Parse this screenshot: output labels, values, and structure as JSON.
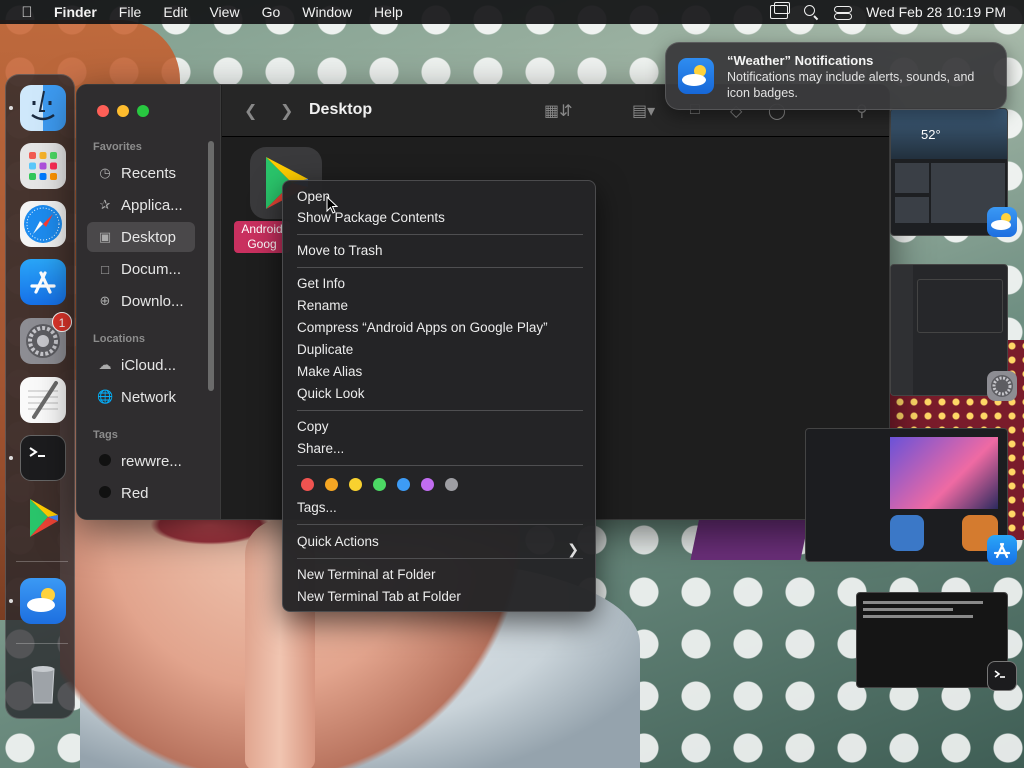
{
  "menubar": {
    "app": "Finder",
    "items": [
      "File",
      "Edit",
      "View",
      "Go",
      "Window",
      "Help"
    ],
    "datetime": "Wed Feb 28  10:19 PM"
  },
  "dock": {
    "apps": [
      {
        "name": "finder",
        "color": "#4aa3f0"
      },
      {
        "name": "launchpad",
        "color": "#d8d8d8"
      },
      {
        "name": "safari",
        "color": "#2a8cf2"
      },
      {
        "name": "app-store",
        "color": "#1d8ef5"
      },
      {
        "name": "system-settings",
        "color": "#8d8d93",
        "badge": "1"
      },
      {
        "name": "textedit",
        "color": "#f4f4f4"
      },
      {
        "name": "terminal",
        "color": "#2b2b2b"
      },
      {
        "name": "google-play",
        "color": "#3a3a3c"
      },
      {
        "name": "weather",
        "color": "#2d86ee"
      },
      {
        "name": "trash",
        "color": "#9aa0a6"
      }
    ]
  },
  "finder": {
    "title": "Desktop",
    "sections": {
      "favorites": "Favorites",
      "locations": "Locations",
      "tags": "Tags"
    },
    "favorites": [
      "Recents",
      "Applica...",
      "Desktop",
      "Docum...",
      "Downlo..."
    ],
    "locations": [
      "iCloud...",
      "Network"
    ],
    "tags": [
      {
        "label": "rewwre...",
        "color": "#1a1a1a"
      },
      {
        "label": "Red",
        "color": "#1a1a1a"
      }
    ],
    "desktop_item": {
      "label_line1": "Android",
      "label_line2": "Goog"
    }
  },
  "context_menu": {
    "items": [
      "Open",
      "Show Package Contents",
      "Move to Trash",
      "Get Info",
      "Rename",
      "Compress “Android Apps on Google Play”",
      "Duplicate",
      "Make Alias",
      "Quick Look",
      "Copy",
      "Share...",
      "Tags...",
      "Quick Actions",
      "New Terminal at Folder",
      "New Terminal Tab at Folder"
    ],
    "tag_colors": [
      "#ef5350",
      "#f5a623",
      "#f8d12f",
      "#4cd964",
      "#3d9bf5",
      "#c16df0",
      "#9e9ea3"
    ]
  },
  "notification": {
    "title": "“Weather” Notifications",
    "body": "Notifications may include alerts, sounds, and icon badges."
  },
  "thumbnail_widget": {
    "temp": "52°"
  }
}
